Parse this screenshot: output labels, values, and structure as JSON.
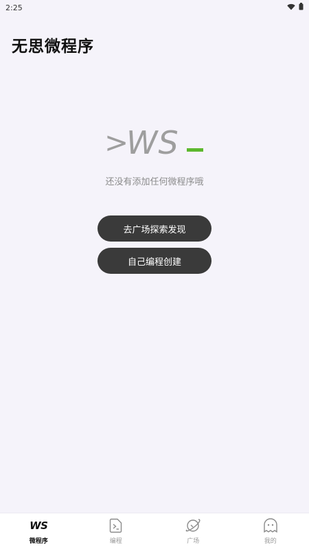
{
  "status_bar": {
    "time": "2:25",
    "wifi_icon": "wifi-icon",
    "battery_icon": "battery-icon"
  },
  "header": {
    "title": "无思微程序"
  },
  "logo": {
    "prompt": ">",
    "text": "WS",
    "cursor": "_",
    "accent_color": "#5cb82e",
    "text_color": "#9e9e9e"
  },
  "empty_state": {
    "message": "还没有添加任何微程序哦"
  },
  "buttons": {
    "explore_label": "去广场探索发现",
    "create_label": "自己编程创建"
  },
  "bottom_nav": {
    "items": [
      {
        "label": "微程序",
        "icon": "ws-logo-icon",
        "text": "WS",
        "active": true
      },
      {
        "label": "编程",
        "icon": "code-file-icon",
        "active": false
      },
      {
        "label": "广场",
        "icon": "planet-icon",
        "active": false
      },
      {
        "label": "我的",
        "icon": "ghost-face-icon",
        "active": false
      }
    ]
  }
}
